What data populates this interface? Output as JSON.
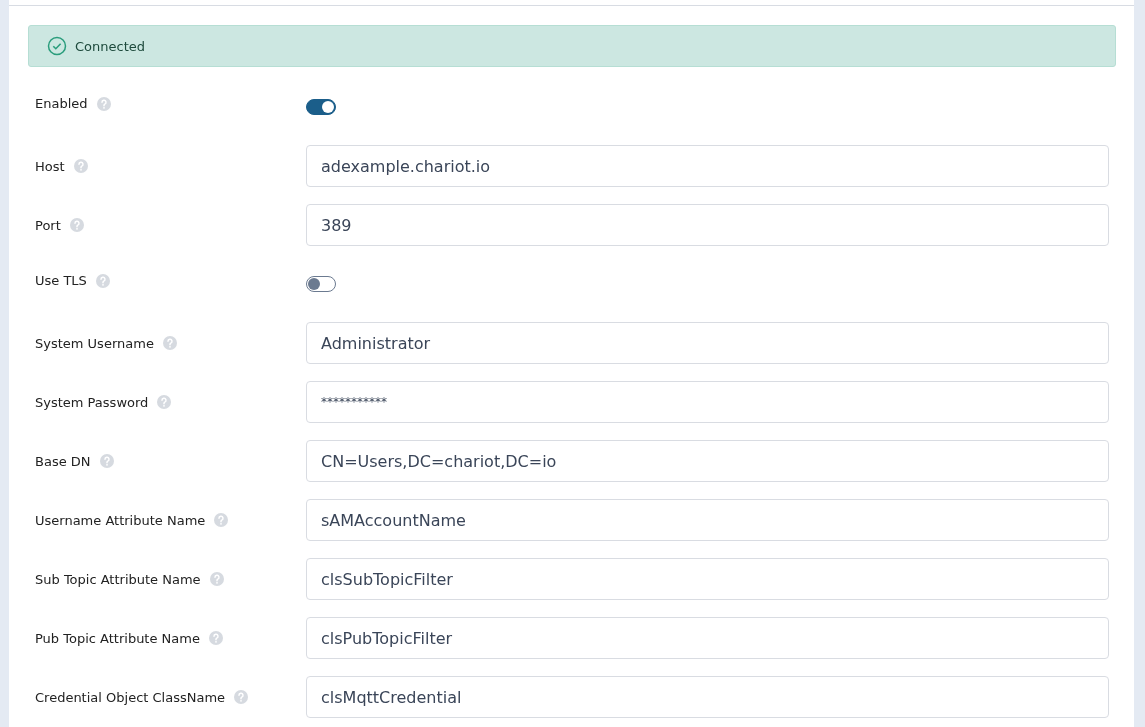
{
  "alert": {
    "text": "Connected",
    "kind": "success"
  },
  "fields": [
    {
      "label": "Enabled",
      "kind": "toggle",
      "on": true
    },
    {
      "label": "Host",
      "kind": "text",
      "value": "adexample.chariot.io"
    },
    {
      "label": "Port",
      "kind": "text",
      "value": "389"
    },
    {
      "label": "Use TLS",
      "kind": "toggle",
      "on": false
    },
    {
      "label": "System Username",
      "kind": "text",
      "value": "Administrator"
    },
    {
      "label": "System Password",
      "kind": "password",
      "value": "***********"
    },
    {
      "label": "Base DN",
      "kind": "text",
      "value": "CN=Users,DC=chariot,DC=io"
    },
    {
      "label": "Username Attribute Name",
      "kind": "text",
      "value": "sAMAccountName"
    },
    {
      "label": "Sub Topic Attribute Name",
      "kind": "text",
      "value": "clsSubTopicFilter"
    },
    {
      "label": "Pub Topic Attribute Name",
      "kind": "text",
      "value": "clsPubTopicFilter"
    },
    {
      "label": "Credential Object ClassName",
      "kind": "text",
      "value": "clsMqttCredential"
    }
  ]
}
